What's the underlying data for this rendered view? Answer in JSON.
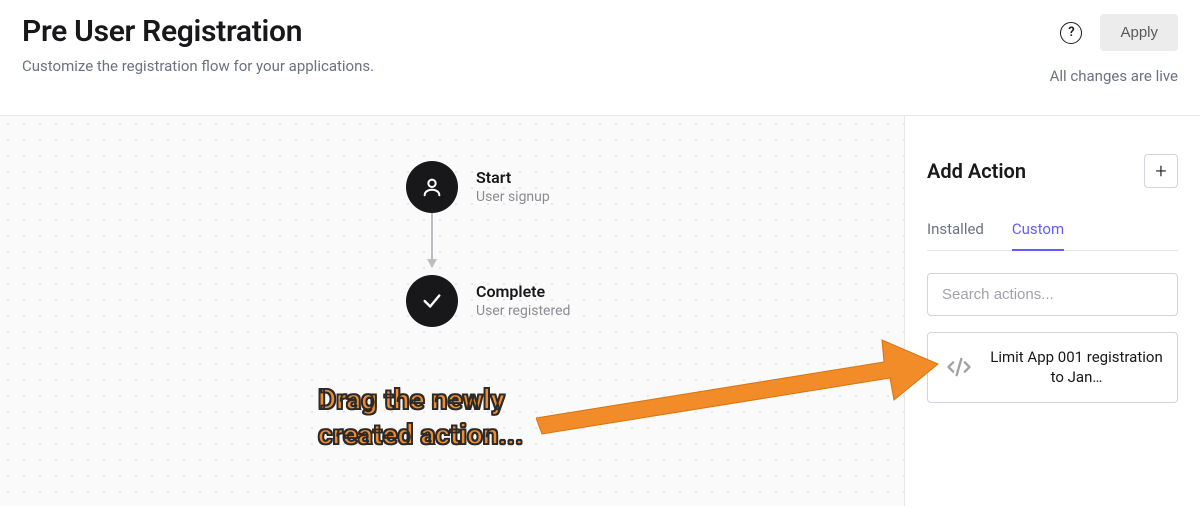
{
  "header": {
    "title": "Pre User Registration",
    "subtitle": "Customize the registration flow for your applications.",
    "apply_label": "Apply",
    "status": "All changes are live"
  },
  "flow": {
    "start": {
      "label": "Start",
      "sub": "User signup",
      "icon": "user-icon"
    },
    "complete": {
      "label": "Complete",
      "sub": "User registered",
      "icon": "check-icon"
    }
  },
  "sidebar": {
    "title": "Add Action",
    "tabs": {
      "installed": "Installed",
      "custom": "Custom"
    },
    "active_tab": "custom",
    "search_placeholder": "Search actions...",
    "actions": [
      {
        "icon": "code-icon",
        "title": "Limit App 001 registration to Jan…"
      }
    ]
  },
  "annotation": {
    "text_line1": "Drag the newly",
    "text_line2": "created action..."
  }
}
